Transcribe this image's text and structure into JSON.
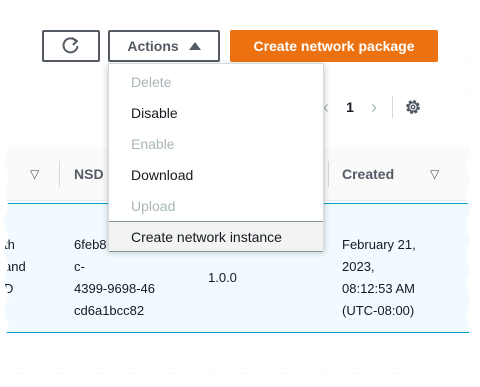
{
  "toolbar": {
    "refresh_icon": "refresh-icon",
    "actions_label": "Actions",
    "create_label": "Create network package",
    "accent_color": "#ec7211"
  },
  "pagination": {
    "current_page": "1",
    "prev_icon": "chevron-left-icon",
    "next_icon": "chevron-right-icon",
    "settings_icon": "gear-icon"
  },
  "table": {
    "columns": [
      "NSD",
      "Created"
    ],
    "row": {
      "name_fragment": [
        "th",
        "and",
        "D"
      ],
      "nsd_id": [
        "6feb8",
        "c-",
        "4399-9698-46",
        "cd6a1bcc82"
      ],
      "version": "1.0.0",
      "created": [
        "February 21,",
        "2023,",
        "08:12:53 AM",
        "(UTC-08:00)"
      ]
    }
  },
  "actions_menu": {
    "items": [
      {
        "label": "Delete",
        "enabled": false
      },
      {
        "label": "Disable",
        "enabled": true
      },
      {
        "label": "Enable",
        "enabled": false
      },
      {
        "label": "Download",
        "enabled": true
      },
      {
        "label": "Upload",
        "enabled": false
      },
      {
        "label": "Create network instance",
        "enabled": true,
        "highlighted": true
      }
    ]
  }
}
